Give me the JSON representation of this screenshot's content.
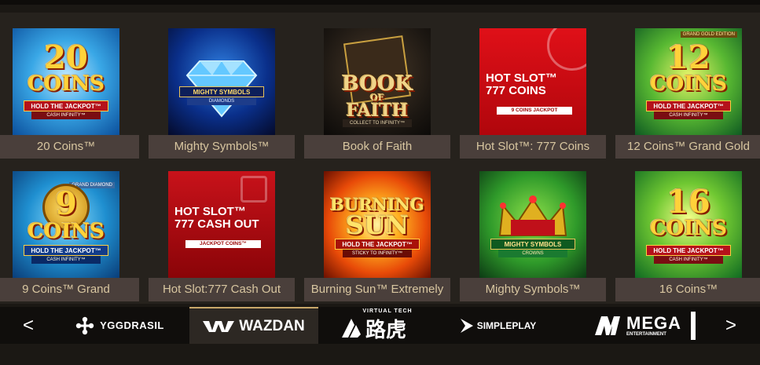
{
  "games": [
    {
      "title": "20 Coins™",
      "art": {
        "number": "20",
        "word": "COINS",
        "tag1": "HOLD THE JACKPOT™",
        "tag2": "CASH INFINITY™"
      }
    },
    {
      "title": "Mighty Symbols™",
      "art": {
        "line1": "MIGHTY SYMBOLS",
        "line2": "DIAMONDS"
      }
    },
    {
      "title": "Book of Faith",
      "art": {
        "line1": "BOOK",
        "line2": "OF",
        "line3": "FAITH",
        "tag": "COLLECT TO INFINITY™"
      }
    },
    {
      "title": "Hot Slot™: 777 Coins",
      "art": {
        "line1": "HOT SLOT™",
        "line2": "777 COINS",
        "tag": "9 COINS JACKPOT"
      }
    },
    {
      "title": "12 Coins™ Grand Gold",
      "art": {
        "badge": "GRAND GOLD EDITION",
        "number": "12",
        "word": "COINS",
        "tag1": "HOLD THE JACKPOT™",
        "tag2": "CASH INFINITY™"
      }
    },
    {
      "title": "9 Coins™ Grand",
      "art": {
        "badge": "GRAND DIAMOND",
        "number": "9",
        "word": "COINS",
        "tag1": "HOLD THE JACKPOT™",
        "tag2": "CASH INFINITY™"
      }
    },
    {
      "title": "Hot Slot:777 Cash Out",
      "art": {
        "line1": "HOT SLOT™",
        "line2": "777 CASH OUT",
        "tag": "JACKPOT COINS™"
      }
    },
    {
      "title": "Burning Sun™ Extremely",
      "art": {
        "line1": "BURNING",
        "line2": "SUN",
        "tag1": "HOLD THE JACKPOT™",
        "tag2": "STICKY TO INFINITY™"
      }
    },
    {
      "title": "Mighty Symbols™",
      "art": {
        "line1": "MIGHTY SYMBOLS",
        "line2": "CROWNS"
      }
    },
    {
      "title": "16 Coins™",
      "art": {
        "number": "16",
        "word": "COINS",
        "tag1": "HOLD THE JACKPOT™",
        "tag2": "CASH INFINITY™"
      }
    }
  ],
  "providers": {
    "prev": "<",
    "next": ">",
    "items": [
      {
        "name": "YGGDRASIL",
        "active": false
      },
      {
        "name": "WAZDAN",
        "active": true
      },
      {
        "name": "VIRTUAL TECH",
        "cn": "路虎",
        "active": false
      },
      {
        "name": "SIMPLEPLAY",
        "active": false
      },
      {
        "name": "MEGA",
        "sub": "ENTERTAINMENT",
        "active": false
      }
    ]
  },
  "colors": {
    "background": "#1b1814",
    "panel": "#26221d",
    "caption_bg": "#4a3f3b",
    "caption_text": "#d8c6a0",
    "provider_bar": "#100e0c",
    "active_provider": "#2d2823"
  }
}
